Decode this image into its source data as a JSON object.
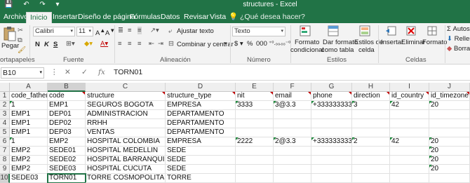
{
  "titlebar": {
    "title": "structures - Excel"
  },
  "tabs": [
    "Archivo",
    "Inicio",
    "Insertar",
    "Diseño de página",
    "Fórmulas",
    "Datos",
    "Revisar",
    "Vista"
  ],
  "tellme": "¿Qué desea hacer?",
  "ribbon": {
    "paste": "Pegar",
    "clipboard_label": "ortapapeles",
    "font_name": "Calibri",
    "font_size": "11",
    "font_label": "Fuente",
    "bold": "N",
    "italic": "K",
    "underline": "S",
    "wrap_text": "Ajustar texto",
    "merge_center": "Combinar y centrar",
    "alignment_label": "Alineación",
    "number_format": "Texto",
    "number_label": "Número",
    "cond_format_1": "Formato",
    "cond_format_2": "condicional",
    "format_table_1": "Dar formato",
    "format_table_2": "como tabla",
    "cell_styles_1": "Estilos de",
    "cell_styles_2": "celda",
    "styles_label": "Estilos",
    "insert": "Insertar",
    "delete": "Eliminar",
    "format": "Formato",
    "cells_label": "Celdas",
    "autosum": "Autos",
    "fill": "Rellen",
    "clear": "Borrar"
  },
  "formula_bar": {
    "name_box": "B10",
    "cancel": "✕",
    "enter": "✓",
    "fx": "fx",
    "formula": "TORN01"
  },
  "columns": [
    "A",
    "B",
    "C",
    "D",
    "E",
    "F",
    "G",
    "H",
    "I",
    "J"
  ],
  "rows": [
    [
      "code_father",
      "code",
      "structure",
      "structure_type",
      "nit",
      "email",
      "phone",
      "direction",
      "id_country",
      "id_timezone"
    ],
    [
      "1",
      "EMP1",
      "SEGUROS BOGOTA",
      "EMPRESA",
      "3333",
      "3@3.3",
      "+33333333333",
      "3",
      "42",
      "20"
    ],
    [
      "EMP1",
      "DEP01",
      "ADMINISTRACION",
      "DEPARTAMENTO",
      "",
      "",
      "",
      "",
      "",
      ""
    ],
    [
      "EMP1",
      "DEP02",
      "RRHH",
      "DEPARTAMENTO",
      "",
      "",
      "",
      "",
      "",
      ""
    ],
    [
      "EMP1",
      "DEP03",
      "VENTAS",
      "DEPARTAMENTO",
      "",
      "",
      "",
      "",
      "",
      ""
    ],
    [
      "1",
      "EMP2",
      "HOSPITAL COLOMBIA",
      "EMPRESA",
      "2222",
      "2@3.3",
      "+33333333333",
      "2",
      "42",
      "20"
    ],
    [
      "EMP2",
      "SEDE01",
      "HOSPITAL MEDELLIN",
      "SEDE",
      "",
      "",
      "",
      "",
      "",
      "20"
    ],
    [
      "EMP2",
      "SEDE02",
      "HOSPITAL BARRANQUILLA",
      "SEDE",
      "",
      "",
      "",
      "",
      "",
      "20"
    ],
    [
      "EMP2",
      "SEDE03",
      "HOSPITAL CUCUTA",
      "SEDE",
      "",
      "",
      "",
      "",
      "",
      "20"
    ],
    [
      "SEDE03",
      "TORN01",
      "TORRE COSMOPOLITAN",
      "TORRE",
      "",
      "",
      "",
      "",
      "",
      ""
    ]
  ],
  "row_numbers": [
    "1",
    "2",
    "3",
    "4",
    "5",
    "6",
    "7",
    "8",
    "9",
    "10"
  ],
  "colors": {
    "accent": "#217346",
    "comment_marker": "#c00000",
    "text_marker": "#1e8a3c"
  }
}
